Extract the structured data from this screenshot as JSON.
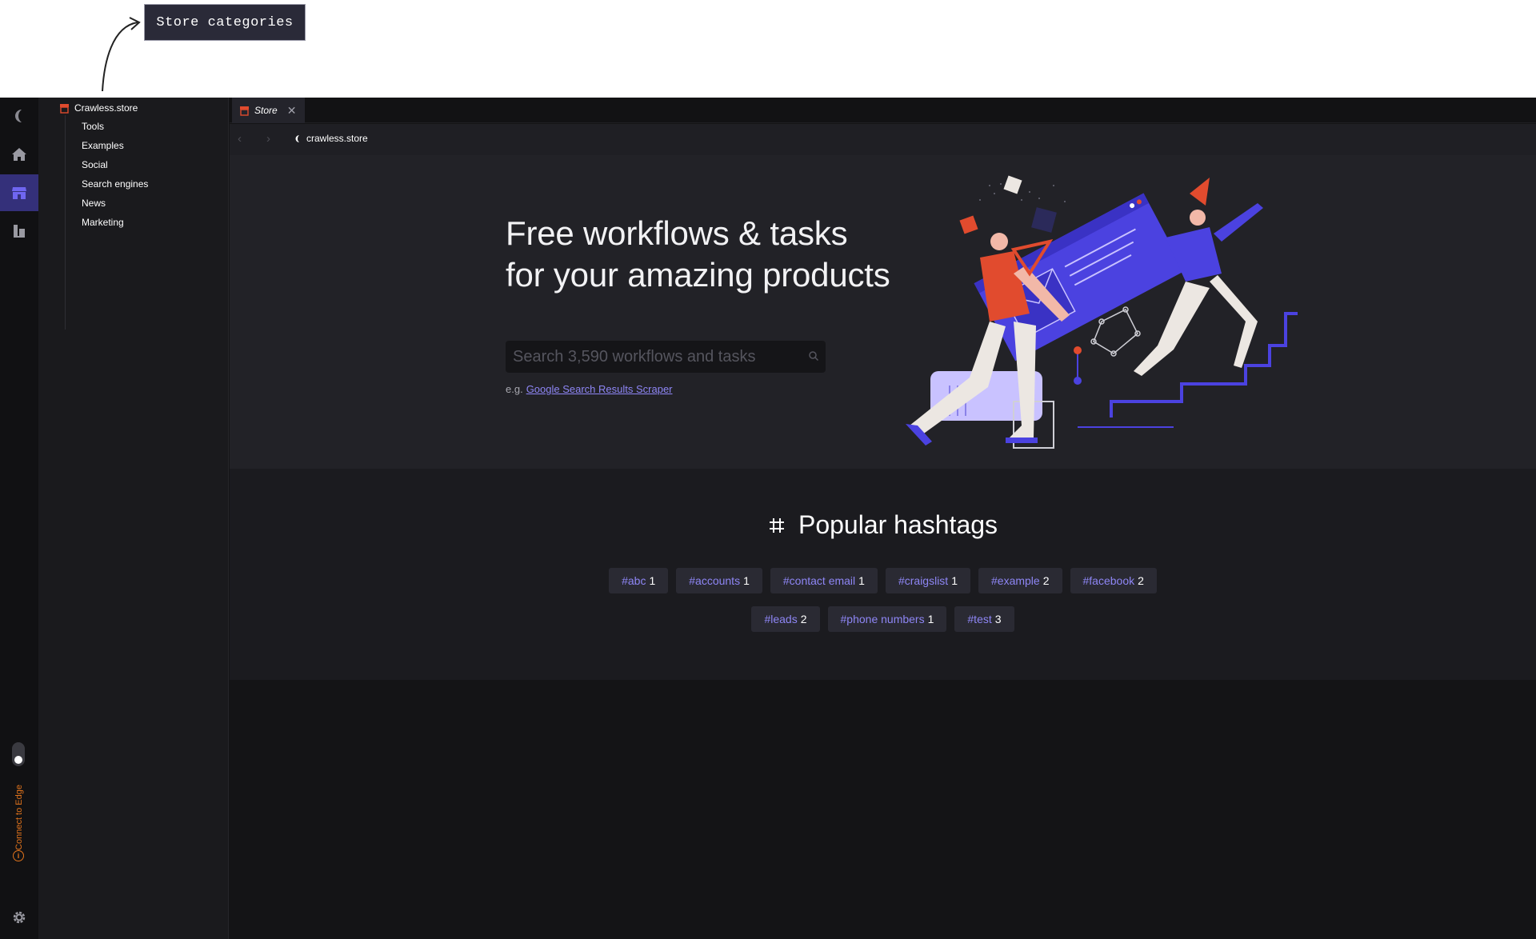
{
  "annotation": {
    "callout": "Store categories"
  },
  "rail": {
    "items": [
      {
        "icon": "logo-icon"
      },
      {
        "icon": "home-icon"
      },
      {
        "icon": "store-icon",
        "active": true
      },
      {
        "icon": "library-icon"
      }
    ],
    "edge_label": "Connect to Edge",
    "info_glyph": "i"
  },
  "tree": {
    "root_label": "Crawless.store",
    "items": [
      "Tools",
      "Examples",
      "Social",
      "Search engines",
      "News",
      "Marketing"
    ]
  },
  "tabs": [
    {
      "label": "Store",
      "active": true
    }
  ],
  "navbar": {
    "url": "crawless.store"
  },
  "hero": {
    "title_line1": "Free workflows & tasks",
    "title_line2": "for your amazing products",
    "search_placeholder": "Search 3,590 workflows and tasks",
    "example_prefix": "e.g.",
    "example_link": "Google Search Results Scraper"
  },
  "hashtags": {
    "heading": "Popular hashtags",
    "row1": [
      {
        "name": "#abc",
        "count": "1"
      },
      {
        "name": "#accounts",
        "count": "1"
      },
      {
        "name": "#contact email",
        "count": "1"
      },
      {
        "name": "#craigslist",
        "count": "1"
      },
      {
        "name": "#example",
        "count": "2"
      },
      {
        "name": "#facebook",
        "count": "2"
      }
    ],
    "row2": [
      {
        "name": "#leads",
        "count": "2"
      },
      {
        "name": "#phone numbers",
        "count": "1"
      },
      {
        "name": "#test",
        "count": "3"
      }
    ]
  },
  "colors": {
    "accent": "#8e86f5",
    "active_rail": "#34307a",
    "edge_orange": "#e2741c"
  }
}
